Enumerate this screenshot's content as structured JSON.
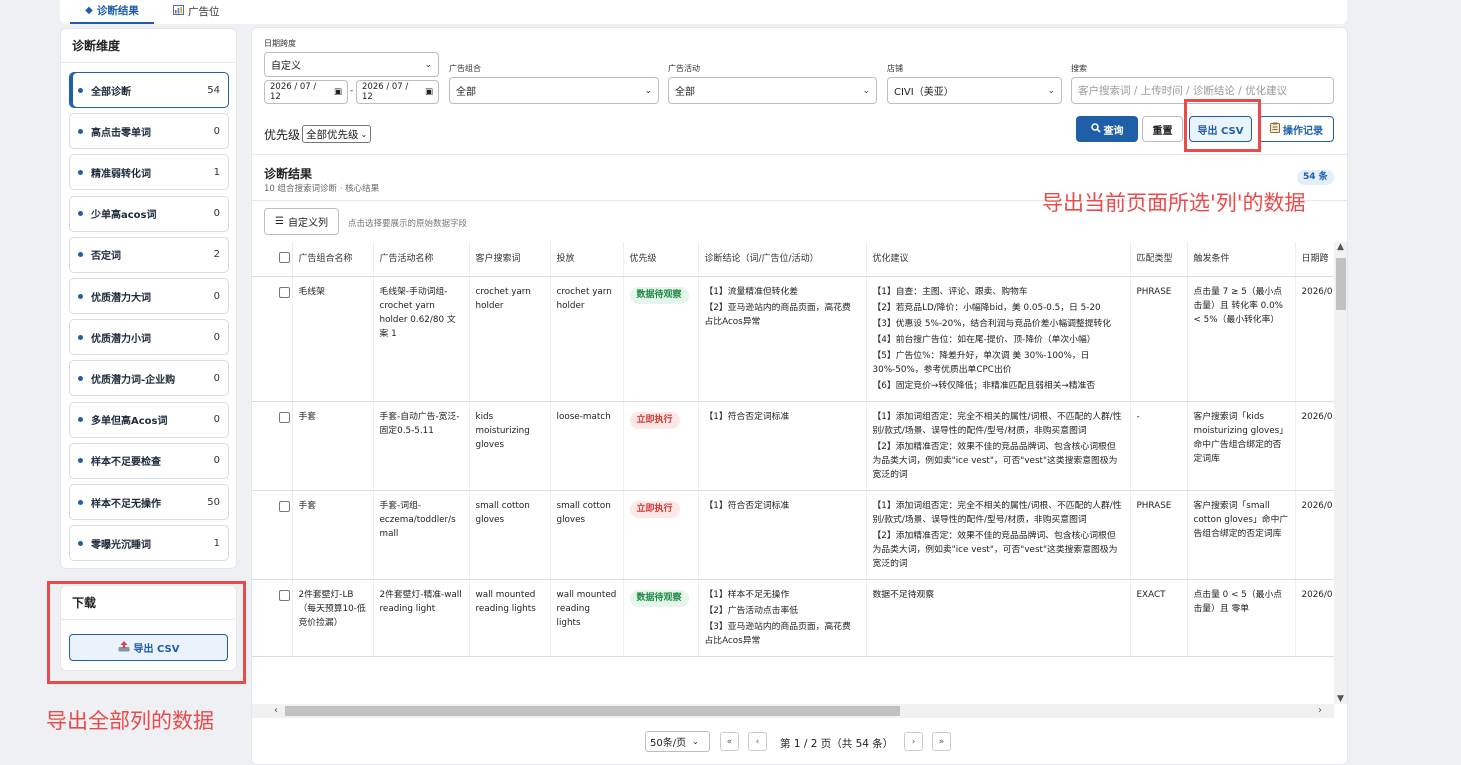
{
  "tabs": [
    {
      "icon": "bug-icon",
      "label": "诊断结果"
    },
    {
      "icon": "bar-chart-icon",
      "label": "广告位"
    }
  ],
  "sidebar": {
    "title": "诊断维度",
    "items": [
      {
        "label": "全部诊断",
        "count": "54",
        "active": true
      },
      {
        "label": "高点击零单词",
        "count": "0"
      },
      {
        "label": "精准弱转化词",
        "count": "1"
      },
      {
        "label": "少单高acos词",
        "count": "0"
      },
      {
        "label": "否定词",
        "count": "2"
      },
      {
        "label": "优质潜力大词",
        "count": "0"
      },
      {
        "label": "优质潜力小词",
        "count": "0"
      },
      {
        "label": "优质潜力词-企业购",
        "count": "0"
      },
      {
        "label": "多单但高Acos词",
        "count": "0"
      },
      {
        "label": "样本不足要检查",
        "count": "0"
      },
      {
        "label": "样本不足无操作",
        "count": "50"
      },
      {
        "label": "零曝光沉睡词",
        "count": "1"
      }
    ]
  },
  "download": {
    "title": "下载",
    "button": "导出 CSV"
  },
  "annotations": {
    "left_note": "导出全部列的数据",
    "right_note": "导出当前页面所选'列'的数据"
  },
  "filters": {
    "date_label": "日期跨度",
    "date_range_value": "自定义",
    "date_start": "2026 / 07 / 12",
    "date_end": "2026 / 07 / 12",
    "date_sep": "-",
    "ad_group_label": "广告组合",
    "ad_group_value": "全部",
    "campaign_label": "广告活动",
    "campaign_value": "全部",
    "store_label": "店铺",
    "store_value": "CIVI（美亚）",
    "search_label": "搜索",
    "search_placeholder": "客户搜索词 / 上传时间 / 诊断结论 / 优化建议",
    "priority_label": "优先级",
    "priority_value": "全部优先级"
  },
  "actions": {
    "query": "查询",
    "reset": "重置",
    "export": "导出 CSV",
    "log": "操作记录"
  },
  "results": {
    "title": "诊断结果",
    "subtitle": "10 组合搜索词诊断 · 核心结果",
    "count_badge": "54 条",
    "custom_columns": "自定义列",
    "custom_hint": "点击选择要展示的原始数据字段"
  },
  "table": {
    "headers": [
      "广告组合名称",
      "广告活动名称",
      "客户搜索词",
      "投放",
      "优先级",
      "诊断结论（词/广告位/活动）",
      "优化建议",
      "匹配类型",
      "触发条件",
      "日期跨"
    ],
    "rows": [
      {
        "group": "毛线架",
        "campaign": "毛线架-手动词组-crochet yarn holder 0.62/80 文案 1",
        "term": "crochet yarn holder",
        "target": "crochet yarn holder",
        "priority": "数据待观察",
        "priority_type": "green",
        "conclusion": [
          "【1】流量精准但转化差",
          "【2】亚马逊站内的商品页面，高花费占比Acos异常"
        ],
        "suggestion": [
          "【1】自查：主图、评论、跟卖、购物车",
          "【2】若竞品LD/降价：小幅降bid，美 0.05-0.5，日 5-20",
          "【3】优惠设 5%-20%，结合利润与竞品价差小幅调整提转化",
          "【4】前台搜广告位：如在尾-提价、顶-降价（单次小幅）",
          "【5】广告位%：降差升好，单次调 美 30%-100%，日 30%-50%，参考优质出单CPC出价",
          "【6】固定竞价→转仅降低；非精准匹配且弱相关→精准否"
        ],
        "match": "PHRASE",
        "trigger": "点击量 7 ≥ 5（最小点击量）且 转化率 0.0% < 5%（最小转化率）",
        "date": "2026/0"
      },
      {
        "group": "手套",
        "campaign": "手套-自动广告-宽泛-固定0.5-5.11",
        "term": "kids moisturizing gloves",
        "target": "loose-match",
        "priority": "立即执行",
        "priority_type": "red",
        "conclusion": [
          "【1】符合否定词标准"
        ],
        "suggestion": [
          "【1】添加词组否定：完全不相关的属性/词根、不匹配的人群/性别/款式/场景、误导性的配件/型号/材质，非购买意图词",
          "【2】添加精准否定：效果不佳的竞品品牌词、包含核心词根但为品类大词，例如卖\"ice vest\"，可否\"vest\"这类搜索意图极为宽泛的词"
        ],
        "match": "-",
        "trigger": "客户搜索词「kids moisturizing gloves」命中广告组合绑定的否定词库",
        "date": "2026/0"
      },
      {
        "group": "手套",
        "campaign": "手套-词组-eczema/toddler/small",
        "term": "small cotton gloves",
        "target": "small cotton gloves",
        "priority": "立即执行",
        "priority_type": "red",
        "conclusion": [
          "【1】符合否定词标准"
        ],
        "suggestion": [
          "【1】添加词组否定：完全不相关的属性/词根、不匹配的人群/性别/款式/场景、误导性的配件/型号/材质，非购买意图词",
          "【2】添加精准否定：效果不佳的竞品品牌词、包含核心词根但为品类大词，例如卖\"ice vest\"，可否\"vest\"这类搜索意图极为宽泛的词"
        ],
        "match": "PHRASE",
        "trigger": "客户搜索词「small cotton gloves」命中广告组合绑定的否定词库",
        "date": "2026/0"
      },
      {
        "group": "2件套壁灯-LB（每天预算10-低竞价捡漏）",
        "campaign": "2件套壁灯-精准-wall reading light",
        "term": "wall mounted reading lights",
        "target": "wall mounted reading lights",
        "priority": "数据待观察",
        "priority_type": "green",
        "conclusion": [
          "【1】样本不足无操作",
          "【2】广告活动点击率低",
          "【3】亚马逊站内的商品页面，高花费占比Acos异常"
        ],
        "suggestion": [
          "数据不足待观察"
        ],
        "match": "EXACT",
        "trigger": "点击量 0 < 5（最小点击量）且 零单",
        "date": "2026/0"
      }
    ]
  },
  "pagination": {
    "page_size": "50条/页",
    "first": "«",
    "prev": "‹",
    "info": "第 1 / 2 页（共 54 条）",
    "next": "›",
    "last": "»"
  },
  "colors": {
    "primary": "#1f5fa8",
    "annotation_red": "#e94b4b",
    "tag_green": "#1d8a44",
    "tag_red": "#d23a3a"
  }
}
